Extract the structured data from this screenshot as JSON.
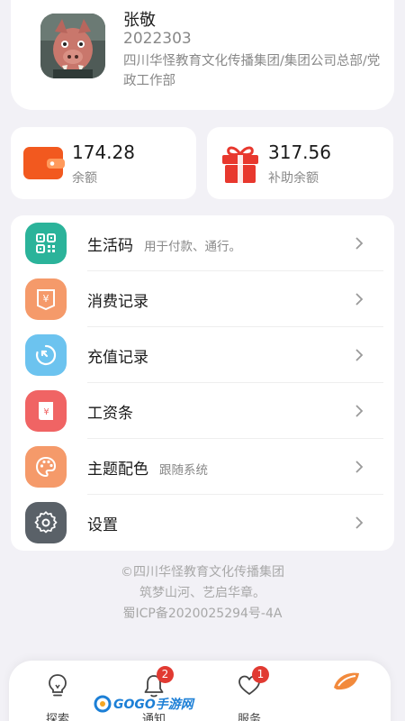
{
  "profile": {
    "name": "张敬",
    "employee_id": "2022303",
    "department": "四川华怪教育文化传播集团/集团公司总部/党政工作部"
  },
  "balances": [
    {
      "value": "174.28",
      "label": "余额",
      "icon": "wallet-icon",
      "color": "#f2591f"
    },
    {
      "value": "317.56",
      "label": "补助余额",
      "icon": "gift-icon",
      "color": "#e8382e"
    }
  ],
  "menu": [
    {
      "label": "生活码",
      "sub": "用于付款、通行。",
      "icon": "qrcode-icon",
      "color": "#2bb39a"
    },
    {
      "label": "消费记录",
      "sub": "",
      "icon": "receipt-icon",
      "color": "#f59a6a"
    },
    {
      "label": "充值记录",
      "sub": "",
      "icon": "recharge-icon",
      "color": "#6cc3ef"
    },
    {
      "label": "工资条",
      "sub": "",
      "icon": "payslip-icon",
      "color": "#f06464"
    },
    {
      "label": "主题配色",
      "sub": "跟随系统",
      "icon": "palette-icon",
      "color": "#f59a6a"
    },
    {
      "label": "设置",
      "sub": "",
      "icon": "settings-icon",
      "color": "#5a6168"
    }
  ],
  "footer": {
    "line1": "©四川华怪教育文化传播集团",
    "line2": "筑梦山河、艺启华章。",
    "line3": "蜀ICP备2020025294号-4A"
  },
  "tabbar": {
    "items": [
      {
        "label": "探索",
        "icon": "lightbulb-icon",
        "badge": ""
      },
      {
        "label": "通知",
        "icon": "bell-icon",
        "badge": "2"
      },
      {
        "label": "服务",
        "icon": "heart-icon",
        "badge": "1"
      },
      {
        "label": "",
        "icon": "leaf-logo-icon",
        "badge": ""
      }
    ]
  },
  "watermark": {
    "text": "GOGO手游网"
  }
}
